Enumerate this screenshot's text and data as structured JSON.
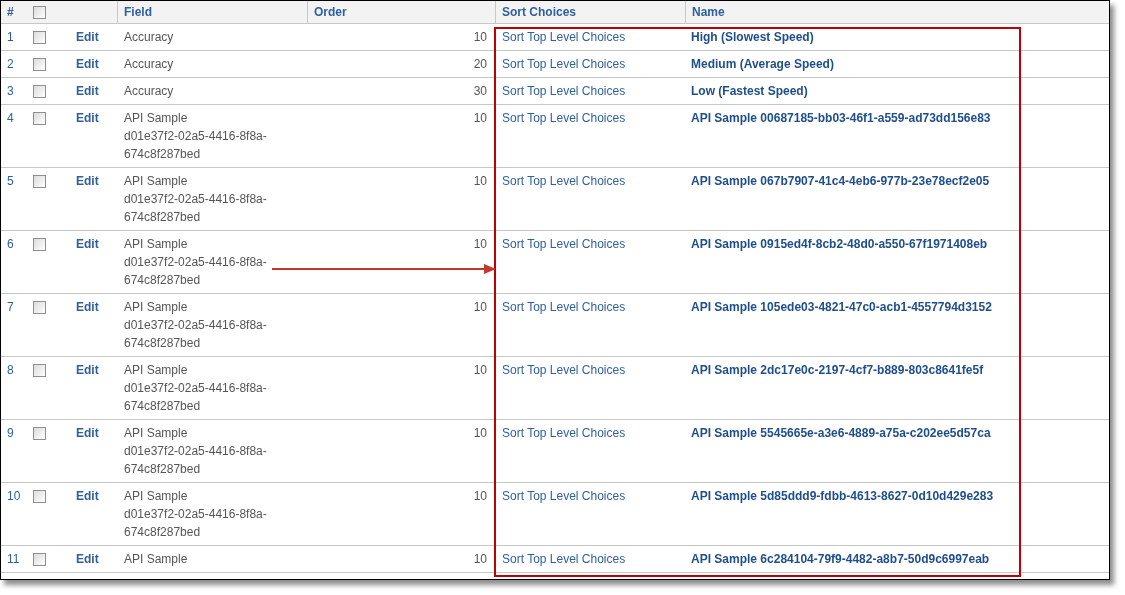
{
  "table": {
    "columns": [
      "#",
      "Field",
      "Order",
      "Sort Choices",
      "Name"
    ],
    "header_checkbox": {
      "checked": false
    },
    "rows": [
      {
        "number": "1",
        "checked": false,
        "edit": "Edit",
        "field": [
          "Accuracy"
        ],
        "order": "10",
        "sort_choices": "Sort Top Level Choices",
        "name": "High (Slowest Speed)"
      },
      {
        "number": "2",
        "checked": false,
        "edit": "Edit",
        "field": [
          "Accuracy"
        ],
        "order": "20",
        "sort_choices": "Sort Top Level Choices",
        "name": "Medium (Average Speed)"
      },
      {
        "number": "3",
        "checked": false,
        "edit": "Edit",
        "field": [
          "Accuracy"
        ],
        "order": "30",
        "sort_choices": "Sort Top Level Choices",
        "name": "Low (Fastest Speed)"
      },
      {
        "number": "4",
        "checked": false,
        "edit": "Edit",
        "field": [
          "API Sample",
          "d01e37f2-02a5-4416-8f8a-",
          "674c8f287bed"
        ],
        "order": "10",
        "sort_choices": "Sort Top Level Choices",
        "name": "API Sample 00687185-bb03-46f1-a559-ad73dd156e83"
      },
      {
        "number": "5",
        "checked": false,
        "edit": "Edit",
        "field": [
          "API Sample",
          "d01e37f2-02a5-4416-8f8a-",
          "674c8f287bed"
        ],
        "order": "10",
        "sort_choices": "Sort Top Level Choices",
        "name": "API Sample 067b7907-41c4-4eb6-977b-23e78ecf2e05"
      },
      {
        "number": "6",
        "checked": false,
        "edit": "Edit",
        "field": [
          "API Sample",
          "d01e37f2-02a5-4416-8f8a-",
          "674c8f287bed"
        ],
        "order": "10",
        "sort_choices": "Sort Top Level Choices",
        "name": "API Sample 0915ed4f-8cb2-48d0-a550-67f1971408eb"
      },
      {
        "number": "7",
        "checked": false,
        "edit": "Edit",
        "field": [
          "API Sample",
          "d01e37f2-02a5-4416-8f8a-",
          "674c8f287bed"
        ],
        "order": "10",
        "sort_choices": "Sort Top Level Choices",
        "name": "API Sample 105ede03-4821-47c0-acb1-4557794d3152"
      },
      {
        "number": "8",
        "checked": false,
        "edit": "Edit",
        "field": [
          "API Sample",
          "d01e37f2-02a5-4416-8f8a-",
          "674c8f287bed"
        ],
        "order": "10",
        "sort_choices": "Sort Top Level Choices",
        "name": "API Sample 2dc17e0c-2197-4cf7-b889-803c8641fe5f"
      },
      {
        "number": "9",
        "checked": false,
        "edit": "Edit",
        "field": [
          "API Sample",
          "d01e37f2-02a5-4416-8f8a-",
          "674c8f287bed"
        ],
        "order": "10",
        "sort_choices": "Sort Top Level Choices",
        "name": "API Sample 5545665e-a3e6-4889-a75a-c202ee5d57ca"
      },
      {
        "number": "10",
        "checked": false,
        "edit": "Edit",
        "field": [
          "API Sample",
          "d01e37f2-02a5-4416-8f8a-",
          "674c8f287bed"
        ],
        "order": "10",
        "sort_choices": "Sort Top Level Choices",
        "name": "API Sample 5d85ddd9-fdbb-4613-8627-0d10d429e283"
      },
      {
        "number": "11",
        "checked": false,
        "edit": "Edit",
        "field": [
          "API Sample"
        ],
        "order": "10",
        "sort_choices": "Sort Top Level Choices",
        "name": "API Sample 6c284104-79f9-4482-a8b7-50d9c6997eab"
      }
    ]
  }
}
